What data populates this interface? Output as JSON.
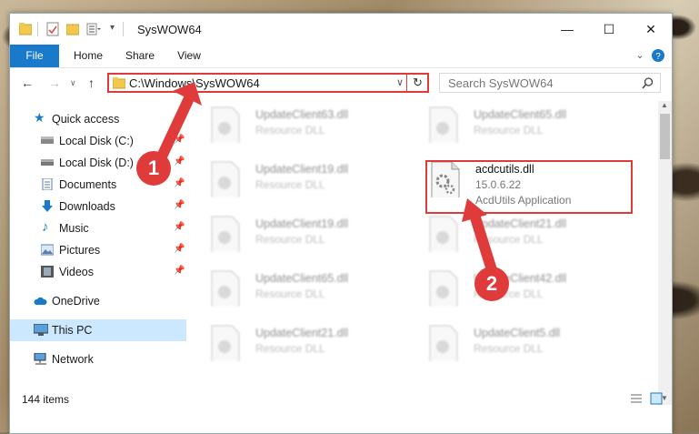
{
  "window": {
    "title": "SysWOW64"
  },
  "ribbon": {
    "tabs": [
      "File",
      "Home",
      "Share",
      "View"
    ]
  },
  "address": {
    "path": "C:\\Windows\\SysWOW64"
  },
  "search": {
    "placeholder": "Search SysWOW64"
  },
  "sidebar": {
    "quick_access": "Quick access",
    "items": [
      {
        "label": "Local Disk (C:)",
        "icon": "drive-icon"
      },
      {
        "label": "Local Disk (D:)",
        "icon": "drive-icon"
      },
      {
        "label": "Documents",
        "icon": "documents-icon"
      },
      {
        "label": "Downloads",
        "icon": "downloads-icon"
      },
      {
        "label": "Music",
        "icon": "music-icon"
      },
      {
        "label": "Pictures",
        "icon": "pictures-icon"
      },
      {
        "label": "Videos",
        "icon": "videos-icon"
      }
    ],
    "onedrive": "OneDrive",
    "this_pc": "This PC",
    "network": "Network"
  },
  "files": [
    {
      "name": "UpdateClient63.dll",
      "desc": "Resource DLL"
    },
    {
      "name": "UpdateClient65.dll",
      "desc": "Resource DLL"
    },
    {
      "name": "UpdateClient19.dll",
      "desc": "Resource DLL"
    },
    {
      "name": "acdcutils.dll",
      "desc": "15.0.6.22",
      "desc2": "AcdUtils Application"
    },
    {
      "name": "UpdateClient19.dll",
      "desc": "Resource DLL"
    },
    {
      "name": "UpdateClient21.dll",
      "desc": "Resource DLL"
    },
    {
      "name": "UpdateClient65.dll",
      "desc": "Resource DLL"
    },
    {
      "name": "UpdateClient42.dll",
      "desc": "Resource DLL"
    },
    {
      "name": "UpdateClient21.dll",
      "desc": "Resource DLL"
    },
    {
      "name": "UpdateClient5.dll",
      "desc": "Resource DLL"
    }
  ],
  "status": {
    "count": "144 items"
  },
  "annotations": {
    "step1": "1",
    "step2": "2"
  },
  "colors": {
    "accent": "#1979ca",
    "highlight": "#e03b3b",
    "selection": "#cce8ff"
  }
}
